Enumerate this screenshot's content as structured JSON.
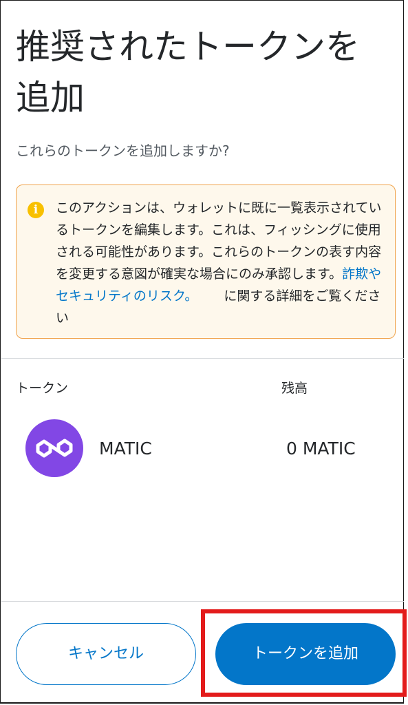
{
  "header": {
    "title": "推奨されたトークンを追加",
    "subtitle": "これらのトークンを追加しますか?"
  },
  "warning": {
    "icon": "info-icon",
    "text": "このアクションは、ウォレットに既に一覧表示されているトークンを編集します。これは、フィッシングに使用される可能性があります。これらのトークンの表す内容を変更する意図が確実な場合にのみ承認します。",
    "link_text": "詐欺やセキュリティのリスク。",
    "suffix": "に関する詳細をご覧ください"
  },
  "table": {
    "column_token": "トークン",
    "column_balance": "残高",
    "rows": [
      {
        "icon": "polygon-matic-icon",
        "symbol": "MATIC",
        "balance": "0 MATIC",
        "icon_color": "#8247e5"
      }
    ]
  },
  "footer": {
    "cancel_label": "キャンセル",
    "add_label": "トークンを追加"
  },
  "colors": {
    "primary": "#0376c9",
    "warning_border": "#f0a24a",
    "warning_bg": "#fef8ec",
    "highlight": "#e31b1b"
  }
}
